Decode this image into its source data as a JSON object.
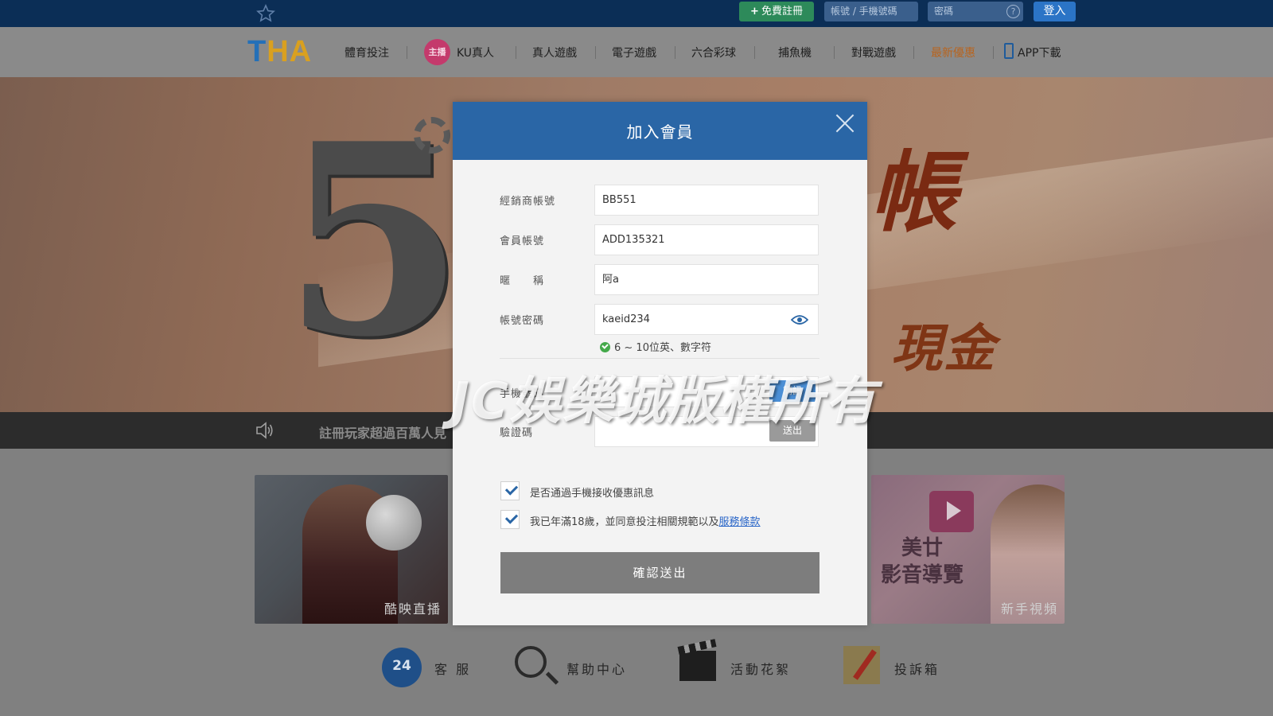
{
  "topbar": {
    "register_label": "免費註冊",
    "account_placeholder": "帳號 / 手機號碼",
    "password_placeholder": "密碼",
    "help_symbol": "?",
    "login_label": "登入"
  },
  "logo": {
    "part1": "T",
    "part2": "HA"
  },
  "nav": {
    "items": [
      "體育投注",
      "KU真人",
      "真人遊戲",
      "電子遊戲",
      "六合彩球",
      "捕魚機",
      "對戰遊戲",
      "最新優惠",
      "APP下載"
    ],
    "ku_badge": "主播"
  },
  "banner": {
    "numeral": "5",
    "headline": "帳",
    "sub": "現金"
  },
  "ticker": {
    "text": "註冊玩家超過百萬人見"
  },
  "cards": {
    "left_label": "酷映直播",
    "right_label": "新手視頻",
    "right_promo_line1": "美廿",
    "right_promo_line2": "影音導覽"
  },
  "footer": {
    "items": [
      {
        "label": "客 服",
        "icon": "24hours-phone-icon",
        "badge": "24"
      },
      {
        "label": "幫助中心",
        "icon": "magnifier-icon"
      },
      {
        "label": "活動花絮",
        "icon": "clapperboard-icon"
      },
      {
        "label": "投訴箱",
        "icon": "pencil-icon"
      }
    ]
  },
  "watermark": "JC娛樂城版權所有",
  "modal": {
    "title": "加入會員",
    "fields": {
      "agent_label": "經銷商帳號",
      "agent_value": "BB551",
      "member_label": "會員帳號",
      "member_value": "ADD135321",
      "nickname_label": "暱　　稱",
      "nickname_value": "阿a",
      "password_label": "帳號密碼",
      "password_value": "kaeid234",
      "password_hint": "6 ~ 10位英、數字符",
      "phone_label": "手機號碼",
      "sms_label": "簡訊",
      "code_label": "驗證碼",
      "send_label": "送出"
    },
    "checks": {
      "promo_label": "是否通過手機接收優惠訊息",
      "terms_prefix": "我已年滿18歲，並同意投注相關規範以及",
      "terms_link": "服務條款"
    },
    "submit_label": "確認送出"
  },
  "colors": {
    "topbar_bg": "#0b2e56",
    "modal_header": "#2a66a6",
    "promo_nav": "#b8641e"
  }
}
